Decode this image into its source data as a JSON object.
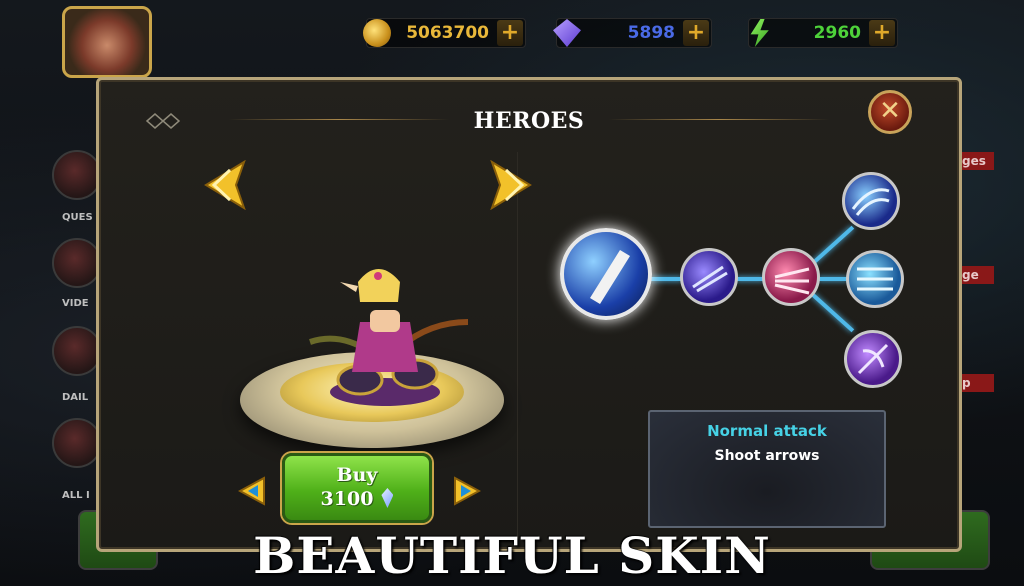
{
  "resources": {
    "gold": "5063700",
    "gems": "5898",
    "energy": "2960",
    "plus": "+"
  },
  "side_menu": {
    "quest": "QUES",
    "video": "VIDE",
    "daily": "DAIL",
    "all": "ALL I"
  },
  "right_tags": {
    "tag1": "ges",
    "tag2": "ge",
    "tag3": "p"
  },
  "panel": {
    "title": "HEROES",
    "close": "✕"
  },
  "buy": {
    "label": "Buy",
    "price": "3100"
  },
  "skill_info": {
    "title": "Normal attack",
    "description": "Shoot arrows"
  },
  "caption": "BEAUTIFUL SKIN",
  "colors": {
    "accent_gold": "#caa54a",
    "buy_green": "#4fb019",
    "skill_line": "#4fb8e8",
    "info_title": "#46d2e6"
  },
  "icons": {
    "gold": "gold-coin-icon",
    "gems": "gem-icon",
    "energy": "energy-bolt-icon"
  }
}
